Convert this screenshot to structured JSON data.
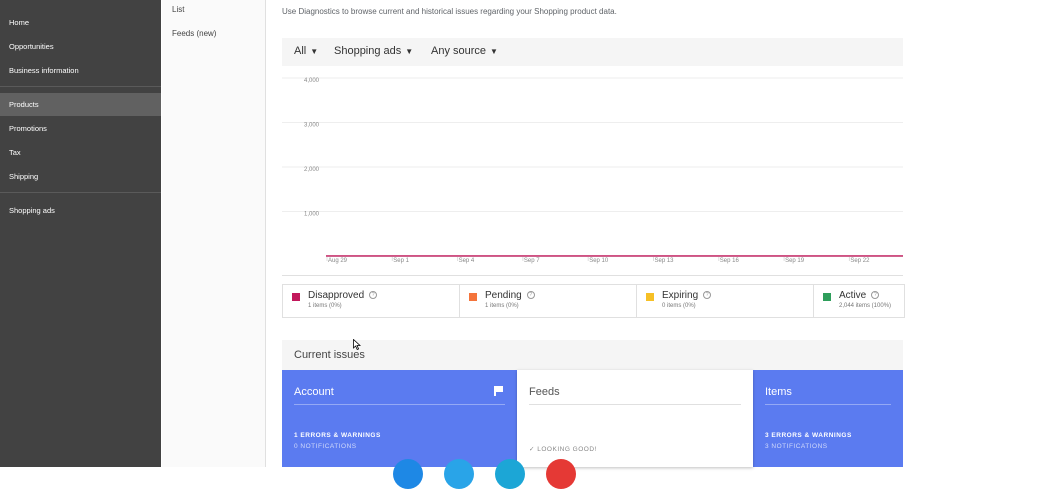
{
  "nav": {
    "items": [
      "Home",
      "Opportunities",
      "Business information",
      "Products",
      "Promotions",
      "Tax",
      "Shipping",
      "Shopping ads"
    ],
    "selected": "Products"
  },
  "subnav": {
    "items": [
      "List",
      "Feeds (new)"
    ]
  },
  "description": "Use Diagnostics to browse current and historical issues regarding your Shopping product data.",
  "filters": {
    "scope": "All",
    "destination": "Shopping ads",
    "source": "Any source"
  },
  "chart_data": {
    "type": "line",
    "x": [
      "Aug 29",
      "Sep 1",
      "Sep 4",
      "Sep 7",
      "Sep 10",
      "Sep 13",
      "Sep 16",
      "Sep 19",
      "Sep 22"
    ],
    "y_ticks": [
      "4,000",
      "3,000",
      "2,000",
      "1,000"
    ],
    "ylim": [
      0,
      4000
    ],
    "grid": true,
    "series": [
      {
        "name": "Disapproved",
        "color": "#c2185b",
        "values": [
          1,
          1,
          1,
          1,
          1,
          1,
          1,
          1,
          1
        ]
      }
    ]
  },
  "legend": [
    {
      "label": "Disapproved",
      "sub": "1 items (0%)",
      "color": "#c2185b"
    },
    {
      "label": "Pending",
      "sub": "1 items (0%)",
      "color": "#f4743b"
    },
    {
      "label": "Expiring",
      "sub": "0 items (0%)",
      "color": "#f6c026"
    },
    {
      "label": "Active",
      "sub": "2,044 items (100%)",
      "color": "#2e9e5b"
    }
  ],
  "issues": {
    "title": "Current issues",
    "cards": [
      {
        "title": "Account",
        "stat1": "1  ERRORS & WARNINGS",
        "stat2": "0  NOTIFICATIONS"
      },
      {
        "title": "Feeds",
        "status": "✓  LOOKING GOOD!"
      },
      {
        "title": "Items",
        "stat1": "3  ERRORS & WARNINGS",
        "stat2": "3  NOTIFICATIONS"
      }
    ]
  },
  "colors": {
    "nav_bg": "#424242",
    "card_blue": "#5b7bf0"
  },
  "icons": {
    "help": "help-circle-icon",
    "flag": "flag-icon",
    "caret": "caret-down-icon"
  }
}
